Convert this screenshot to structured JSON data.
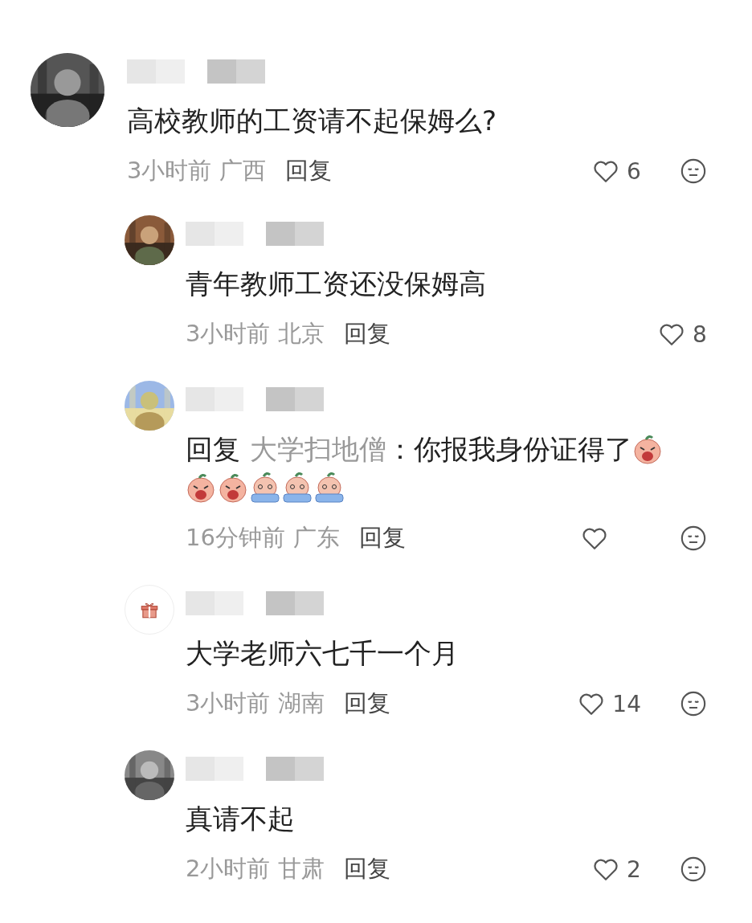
{
  "comments": [
    {
      "text": "高校教师的工资请不起保姆么?",
      "time": "3小时前",
      "region": "广西",
      "reply_button": "回复",
      "liked": false,
      "likes": "6",
      "dislike_icon": true,
      "children": [
        {
          "text": "青年教师工资还没保姆高",
          "time": "3小时前",
          "region": "北京",
          "reply_button": "回复",
          "liked": false,
          "likes": "8",
          "dislike_icon": false
        },
        {
          "reply_label": "回复",
          "reply_to": "大学扫地僧",
          "text": "：你报我身份证得了",
          "emojis": [
            {
              "kind": "wailing"
            },
            {
              "kind": "wailing"
            },
            {
              "kind": "wailing"
            },
            {
              "kind": "tearful"
            },
            {
              "kind": "tearful"
            },
            {
              "kind": "tearful"
            }
          ],
          "time": "16分钟前",
          "region": "广东",
          "reply_button": "回复",
          "liked": false,
          "dislike_icon": true
        },
        {
          "avatar": {
            "kind": "gift"
          },
          "text": "大学老师六七千一个月",
          "time": "3小时前",
          "region": "湖南",
          "reply_button": "回复",
          "liked": false,
          "likes": "14",
          "dislike_icon": true
        },
        {
          "text": "真请不起",
          "time": "2小时前",
          "region": "甘肃",
          "reply_button": "回复",
          "liked": false,
          "likes": "2",
          "dislike_icon": true
        }
      ]
    }
  ]
}
